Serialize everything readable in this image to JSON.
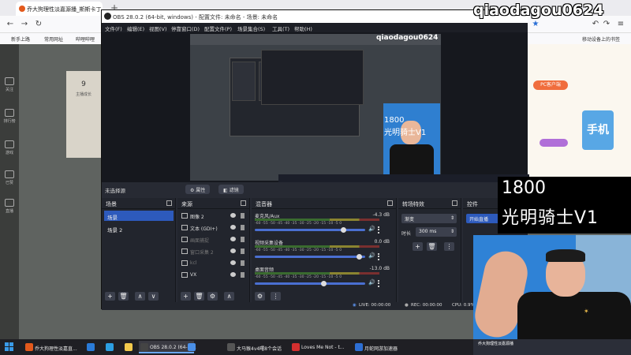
{
  "browser": {
    "tab_title": "乔大狗理性淡嘉源播_斯斯卡丁",
    "new_tab": "+",
    "bookmarks": [
      "新手上路",
      "常用网址",
      "哔哩哔哩"
    ],
    "bookmarks_right": "移动设备上的书签"
  },
  "site": {
    "left_nav": [
      "关注",
      "排行榜",
      "游戏",
      "已赞",
      "直播"
    ],
    "card_count": "9",
    "card_label": "主播成长",
    "pc_button": "PC客户端",
    "mobile_art": "手机"
  },
  "obs": {
    "title": "OBS 28.0.2 (64-bit, windows) - 配置文件: 未命名 - 场景: 未命名",
    "menu": [
      "文件(F)",
      "编辑(E)",
      "视图(V)",
      "停靠窗口(D)",
      "配置文件(P)",
      "场景集合(S)",
      "工具(T)",
      "帮助(H)"
    ],
    "preview_watermark": "qiaodagou0624",
    "preview_number": "1800",
    "preview_name": "光明骑士V1",
    "no_source": "未选择源",
    "properties": "属性",
    "filters": "滤镜",
    "docks": {
      "scenes": "场景",
      "sources": "来源",
      "mixer": "混音器",
      "transitions": "转场特效",
      "controls": "控件"
    },
    "scenes": [
      "场景",
      "场景 2"
    ],
    "sources": [
      {
        "name": "图像 2",
        "dim": false
      },
      {
        "name": "文本 (GDI+)",
        "dim": false
      },
      {
        "name": "画面捕捉",
        "dim": true
      },
      {
        "name": "窗口采集 2",
        "dim": true
      },
      {
        "name": "kcl",
        "dim": true
      },
      {
        "name": "VX",
        "dim": false
      }
    ],
    "mixer": [
      {
        "label": "麦克风/Aux",
        "db": "-4.3 dB",
        "level": 0.78
      },
      {
        "label": "视频采集设备",
        "db": "0.0 dB",
        "level": 0.92
      },
      {
        "label": "桌面音频",
        "db": "-13.0 dB",
        "level": 0.6
      }
    ],
    "mixer_ticks": "-60 -55 -50 -45 -40 -35 -30 -25 -20 -15 -10 -5 0",
    "transition": "渐变",
    "duration_label": "时长",
    "duration_value": "300 ms",
    "start_stream": "开始直播",
    "status": {
      "live": "LIVE: 00:00:00",
      "rec": "REC: 00:00:00",
      "cpu": "CPU: 0.9%"
    }
  },
  "overlay": {
    "watermark": "qiaodagou0624",
    "number": "1800",
    "name": "光明骑士V1",
    "cam_label": "乔大狗理性淡嘉源播"
  },
  "taskbar": [
    {
      "label": "乔大狗理性淡嘉直...",
      "color": "#e3591c"
    },
    {
      "label": "",
      "color": "#2a7bd8"
    },
    {
      "label": "",
      "color": "#2c9fe2"
    },
    {
      "label": "",
      "color": "#f2c94c"
    },
    {
      "label": "OBS 28.0.2 (64-bi...",
      "color": "#444"
    },
    {
      "label": "",
      "color": "#4a8fe7"
    },
    {
      "label": "大马猴4v4曙8个会话",
      "color": "#555"
    },
    {
      "label": "Loves Me Not - t...",
      "color": "#d32f2f"
    },
    {
      "label": "月蛇网游加速器",
      "color": "#2d6fd4"
    }
  ]
}
